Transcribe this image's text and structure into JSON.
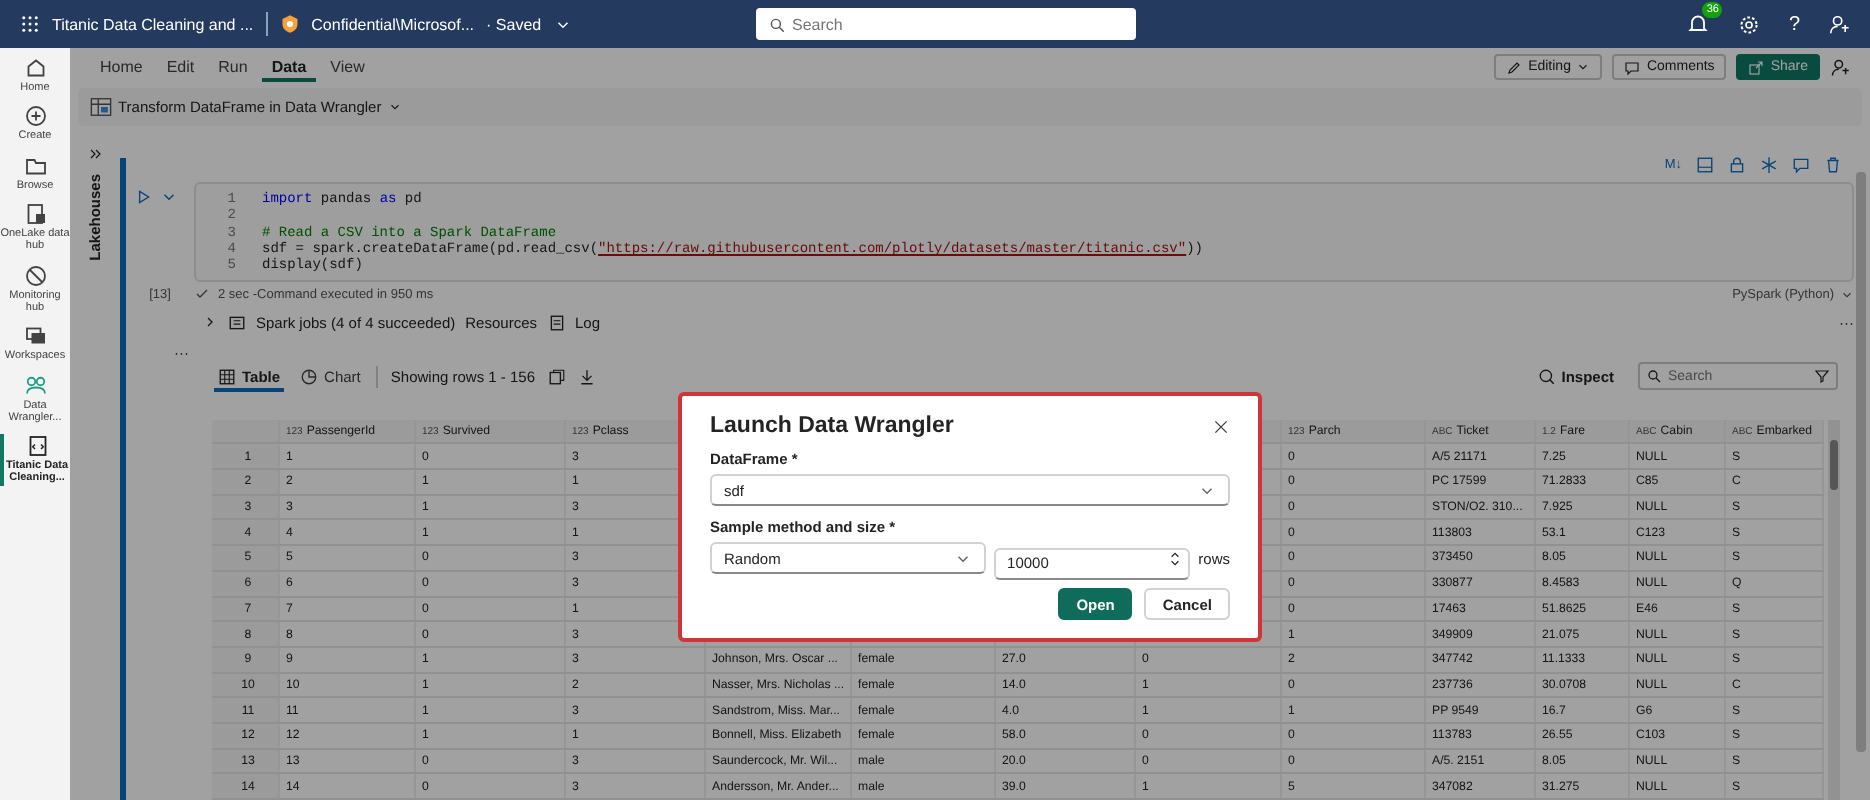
{
  "top_bar": {
    "title": "Titanic Data Cleaning and ...",
    "sensitivity": "Confidential\\Microsof...",
    "save_state": "· Saved",
    "search": {
      "placeholder": "Search"
    },
    "notification_count": "36",
    "help": "?"
  },
  "rail": {
    "items": [
      {
        "label": "Home",
        "kind": "home",
        "selected": false
      },
      {
        "label": "Create",
        "kind": "create",
        "selected": false
      },
      {
        "label": "Browse",
        "kind": "browse",
        "selected": false
      },
      {
        "label": "OneLake data hub",
        "kind": "onelake",
        "selected": false
      },
      {
        "label": "Monitoring hub",
        "kind": "monitor",
        "selected": false
      },
      {
        "label": "Workspaces",
        "kind": "workspaces",
        "selected": false
      },
      {
        "label": "Data Wrangler...",
        "kind": "wrangler",
        "selected": false
      },
      {
        "label": "Titanic Data Cleaning...",
        "kind": "notebook",
        "selected": true
      }
    ]
  },
  "ribbon": {
    "tabs": [
      {
        "label": "Home",
        "selected": false
      },
      {
        "label": "Edit",
        "selected": false
      },
      {
        "label": "Run",
        "selected": false
      },
      {
        "label": "Data",
        "selected": true
      },
      {
        "label": "View",
        "selected": false
      }
    ],
    "actions": [
      {
        "label": "Editing",
        "kind": "dropdown"
      },
      {
        "label": "Comments",
        "kind": "outline"
      },
      {
        "label": "Share",
        "kind": "primary"
      }
    ],
    "toolbar": {
      "label": "Transform DataFrame in Data Wrangler"
    }
  },
  "explorer": {
    "label": "Lakehouses"
  },
  "cell": {
    "markdown_tool": "M↓",
    "lines": [
      {
        "number": "1",
        "tokens": [
          {
            "text": "import",
            "kind": "keyword"
          },
          {
            "text": " pandas ",
            "kind": "plain"
          },
          {
            "text": "as",
            "kind": "keyword"
          },
          {
            "text": " pd",
            "kind": "plain"
          }
        ]
      },
      {
        "number": "2"
      },
      {
        "number": "3",
        "tokens": [
          {
            "text": "# Read a CSV into a Spark DataFrame",
            "kind": "comment"
          }
        ]
      },
      {
        "number": "4",
        "tokens": [
          {
            "text": "sdf = spark.createDataFrame(pd.read_csv(",
            "kind": "plain"
          },
          {
            "text": "\"https://raw.githubusercontent.com/plotly/datasets/master/titanic.csv\"",
            "kind": "string"
          },
          {
            "text": "))",
            "kind": "plain"
          }
        ]
      },
      {
        "number": "5",
        "tokens": [
          {
            "text": "display(sdf)",
            "kind": "plain"
          }
        ]
      }
    ],
    "execution_count": "[13]",
    "status": "2 sec -Command executed in 950 ms",
    "language": "PySpark (Python)"
  },
  "output": {
    "spark_jobs": "Spark jobs (4 of 4 succeeded)",
    "resources": "Resources",
    "log": "Log",
    "more": "···",
    "side_more": "···"
  },
  "table_view": {
    "tabs": [
      {
        "label": "Table",
        "kind": "table",
        "selected": true
      },
      {
        "label": "Chart",
        "kind": "chart",
        "selected": false
      }
    ],
    "row_info": "Showing rows 1 - 156",
    "inspect": "Inspect",
    "search": {
      "placeholder": "Search"
    }
  },
  "table": {
    "columns": [
      {
        "type": "123",
        "label": "PassengerId"
      },
      {
        "type": "123",
        "label": "Survived"
      },
      {
        "type": "123",
        "label": "Pclass"
      },
      {},
      {},
      {},
      {},
      {
        "type": "123",
        "label": "Parch"
      },
      {
        "type": "ABC",
        "label": "Ticket"
      },
      {
        "type": "1.2",
        "label": "Fare"
      },
      {
        "type": "ABC",
        "label": "Cabin"
      },
      {
        "type": "ABC",
        "label": "Embarked"
      }
    ],
    "rows": [
      {
        "index": "1",
        "cells": [
          "1",
          "0",
          "3",
          null,
          null,
          null,
          null,
          "0",
          "A/5 21171",
          "7.25",
          "NULL",
          "S"
        ]
      },
      {
        "index": "2",
        "cells": [
          "2",
          "1",
          "1",
          null,
          null,
          null,
          null,
          "0",
          "PC 17599",
          "71.2833",
          "C85",
          "C"
        ]
      },
      {
        "index": "3",
        "cells": [
          "3",
          "1",
          "3",
          null,
          null,
          null,
          null,
          "0",
          "STON/O2. 310...",
          "7.925",
          "NULL",
          "S"
        ]
      },
      {
        "index": "4",
        "cells": [
          "4",
          "1",
          "1",
          null,
          null,
          null,
          null,
          "0",
          "113803",
          "53.1",
          "C123",
          "S"
        ]
      },
      {
        "index": "5",
        "cells": [
          "5",
          "0",
          "3",
          null,
          null,
          null,
          null,
          "0",
          "373450",
          "8.05",
          "NULL",
          "S"
        ]
      },
      {
        "index": "6",
        "cells": [
          "6",
          "0",
          "3",
          null,
          null,
          null,
          null,
          "0",
          "330877",
          "8.4583",
          "NULL",
          "Q"
        ]
      },
      {
        "index": "7",
        "cells": [
          "7",
          "0",
          "1",
          null,
          null,
          null,
          null,
          "0",
          "17463",
          "51.8625",
          "E46",
          "S"
        ]
      },
      {
        "index": "8",
        "cells": [
          "8",
          "0",
          "3",
          null,
          null,
          null,
          null,
          "1",
          "349909",
          "21.075",
          "NULL",
          "S"
        ]
      },
      {
        "index": "9",
        "cells": [
          "9",
          "1",
          "3",
          "Johnson, Mrs. Oscar ...",
          "female",
          "27.0",
          "0",
          "2",
          "347742",
          "11.1333",
          "NULL",
          "S"
        ]
      },
      {
        "index": "10",
        "cells": [
          "10",
          "1",
          "2",
          "Nasser, Mrs. Nicholas ...",
          "female",
          "14.0",
          "1",
          "0",
          "237736",
          "30.0708",
          "NULL",
          "C"
        ]
      },
      {
        "index": "11",
        "cells": [
          "11",
          "1",
          "3",
          "Sandstrom, Miss. Mar...",
          "female",
          "4.0",
          "1",
          "1",
          "PP 9549",
          "16.7",
          "G6",
          "S"
        ]
      },
      {
        "index": "12",
        "cells": [
          "12",
          "1",
          "1",
          "Bonnell, Miss. Elizabeth",
          "female",
          "58.0",
          "0",
          "0",
          "113783",
          "26.55",
          "C103",
          "S"
        ]
      },
      {
        "index": "13",
        "cells": [
          "13",
          "0",
          "3",
          "Saundercock, Mr. Wil...",
          "male",
          "20.0",
          "0",
          "0",
          "A/5. 2151",
          "8.05",
          "NULL",
          "S"
        ]
      },
      {
        "index": "14",
        "cells": [
          "14",
          "0",
          "3",
          "Andersson, Mr. Ander...",
          "male",
          "39.0",
          "1",
          "5",
          "347082",
          "31.275",
          "NULL",
          "S"
        ]
      }
    ]
  },
  "dialog": {
    "title": "Launch Data Wrangler",
    "dataframe_label": "DataFrame *",
    "dataframe": "sdf",
    "sample_label": "Sample method and size *",
    "method": "Random",
    "size": "10000",
    "unit": "rows",
    "buttons": [
      {
        "label": "Open",
        "kind": "primary"
      },
      {
        "label": "Cancel",
        "kind": "secondary"
      }
    ]
  }
}
